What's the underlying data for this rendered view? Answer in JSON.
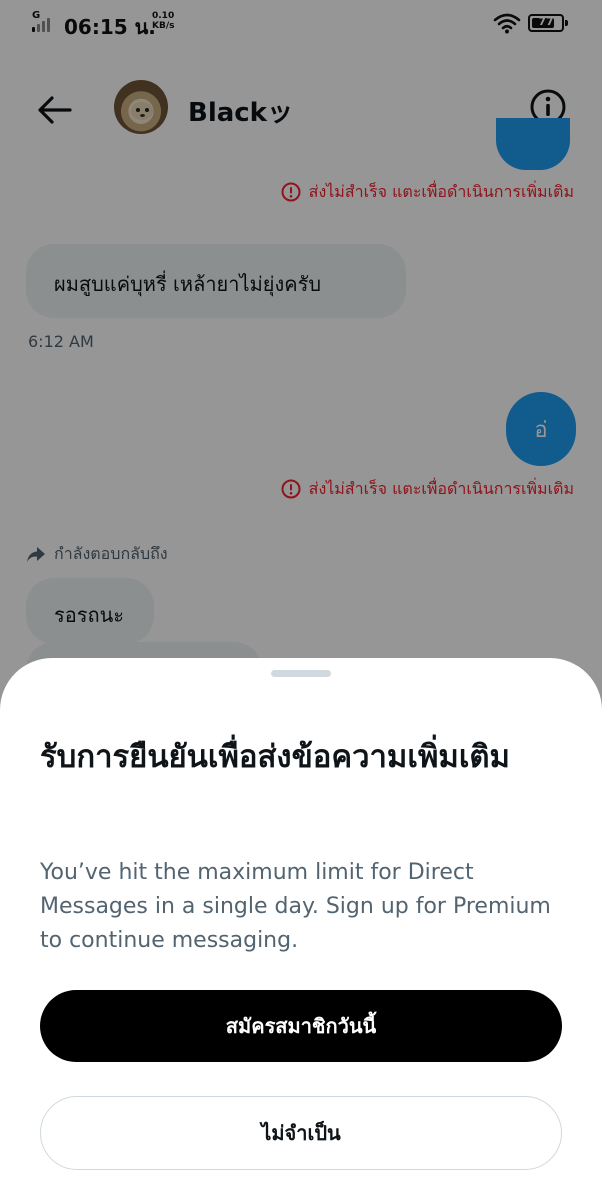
{
  "status_bar": {
    "network": "G",
    "time": "06:15 น.",
    "speed_value": "0.10",
    "speed_unit": "KB/s",
    "battery": "77"
  },
  "header": {
    "contact_name": "Blackッ"
  },
  "conversation": {
    "fail_notice_1": "ส่งไม่สำเร็จ แตะเพื่อดำเนินการเพิ่มเติม",
    "incoming_message_1": "ผมสูบแค่บุหรี่ เหล้ายาไม่ยุ่งครับ",
    "incoming_time_1": "6:12 AM",
    "outgoing_message_2": "อ่",
    "fail_notice_2": "ส่งไม่สำเร็จ แตะเพื่อดำเนินการเพิ่มเติม",
    "reply_indicator": "กำลังตอบกลับถึง",
    "incoming_message_3": "รอรถนะ"
  },
  "sheet": {
    "title": "รับการยืนยันเพื่อส่งข้อความเพิ่มเติม",
    "body": "You’ve hit the maximum limit for Direct Messages in a single day. Sign up for Premium to continue messaging.",
    "primary_button": "สมัครสมาชิกวันนี้",
    "secondary_button": "ไม่จำเป็น"
  },
  "colors": {
    "accent_blue": "#1d9bf0",
    "error_red": "#f4212e",
    "primary_button_bg": "#000000",
    "overlay": "rgba(0,0,0,0.41)"
  },
  "icons": {
    "back": "arrow-left-icon",
    "info": "info-circle-icon",
    "error": "alert-circle-icon",
    "reply": "reply-arrow-icon",
    "wifi": "wifi-icon",
    "battery": "battery-icon",
    "signal": "signal-icon"
  }
}
